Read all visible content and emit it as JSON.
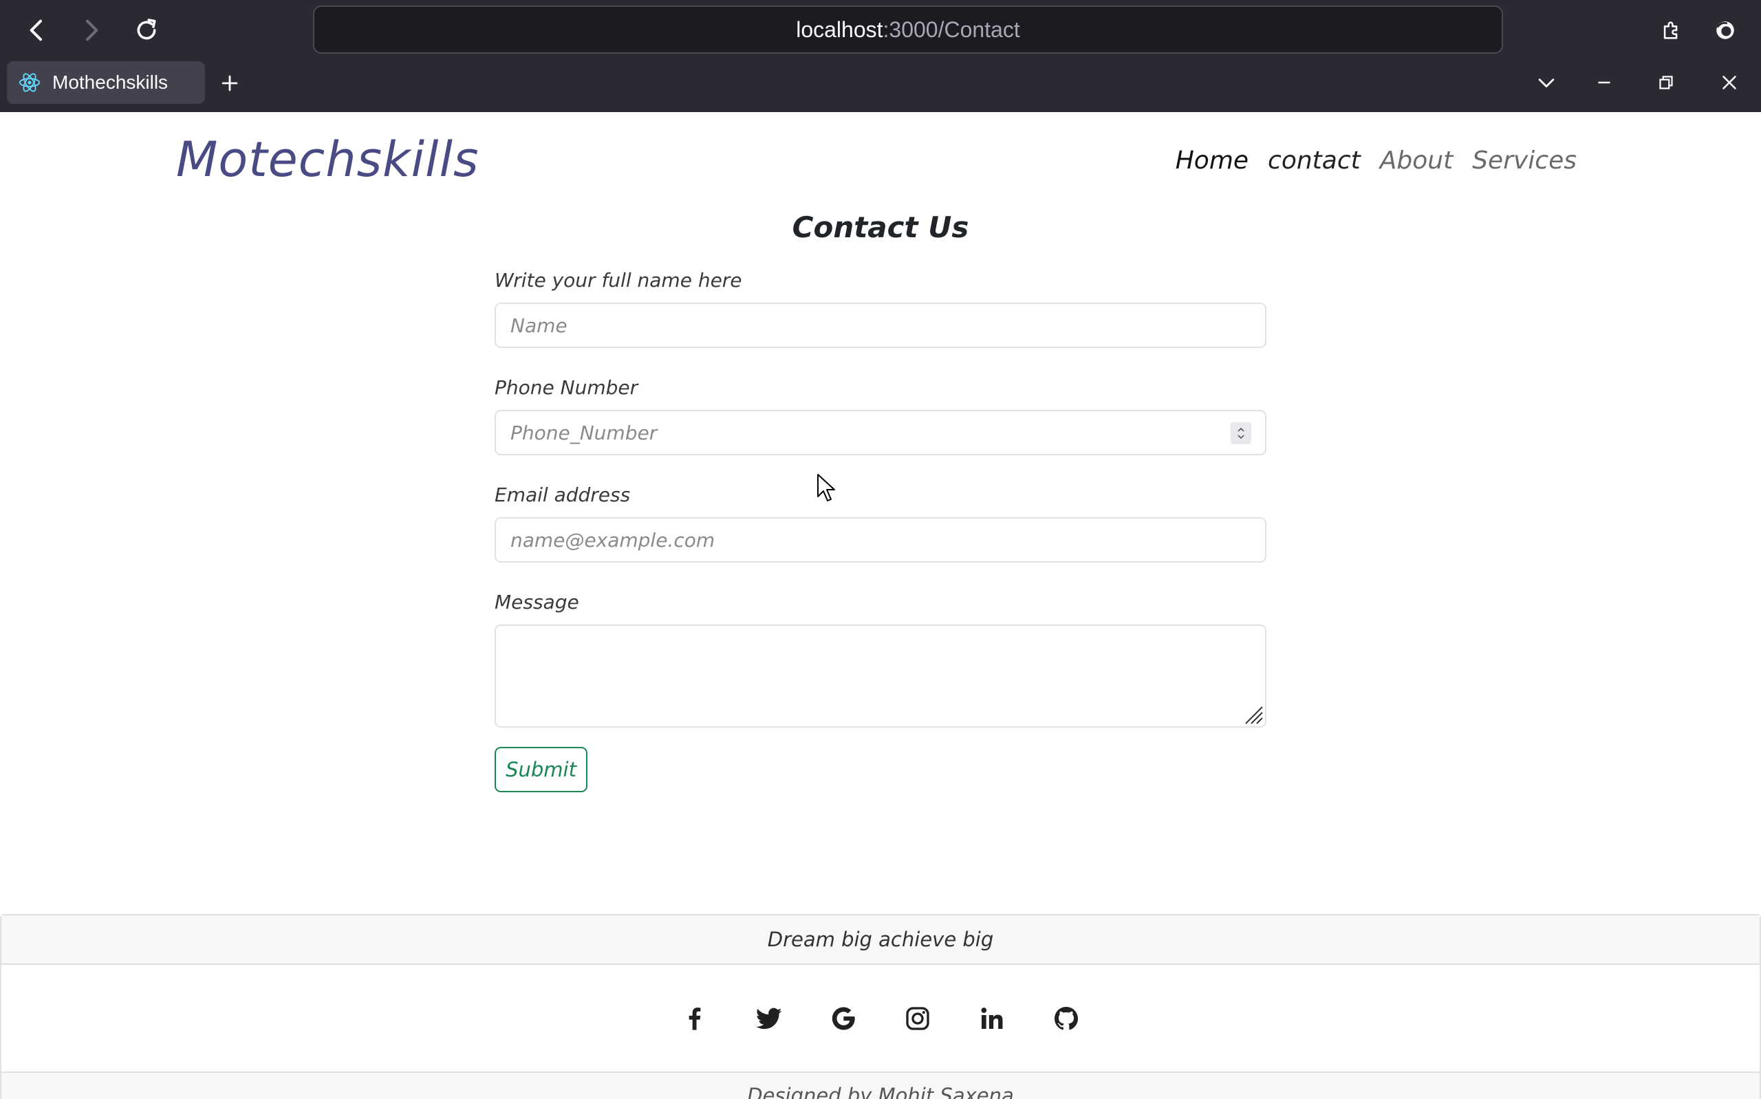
{
  "browser": {
    "url_host": "localhost",
    "url_path": ":3000/Contact",
    "tab_title": "Mothechskills",
    "new_tab_icon": "plus-icon",
    "colors": {
      "chrome_bg": "#2b2a33",
      "tab_bg": "#42414d",
      "url_bg": "#1c1b22"
    }
  },
  "header": {
    "brand": "Motechskills",
    "nav": {
      "home": "Home",
      "contact": "contact",
      "about": "About",
      "services": "Services"
    }
  },
  "form": {
    "title": "Contact Us",
    "name_label": "Write your full name here",
    "name_placeholder": "Name",
    "phone_label": "Phone Number",
    "phone_placeholder": "Phone_Number",
    "email_label": "Email address",
    "email_placeholder": "name@example.com",
    "message_label": "Message",
    "submit_label": "Submit",
    "colors": {
      "submit": "#198754",
      "brand": "#4a4a85"
    }
  },
  "footer": {
    "tagline": "Dream big achieve big",
    "social_icons": [
      "facebook-icon",
      "twitter-icon",
      "google-icon",
      "instagram-icon",
      "linkedin-icon",
      "github-icon"
    ],
    "credit": "Designed by Mohit Saxena"
  }
}
